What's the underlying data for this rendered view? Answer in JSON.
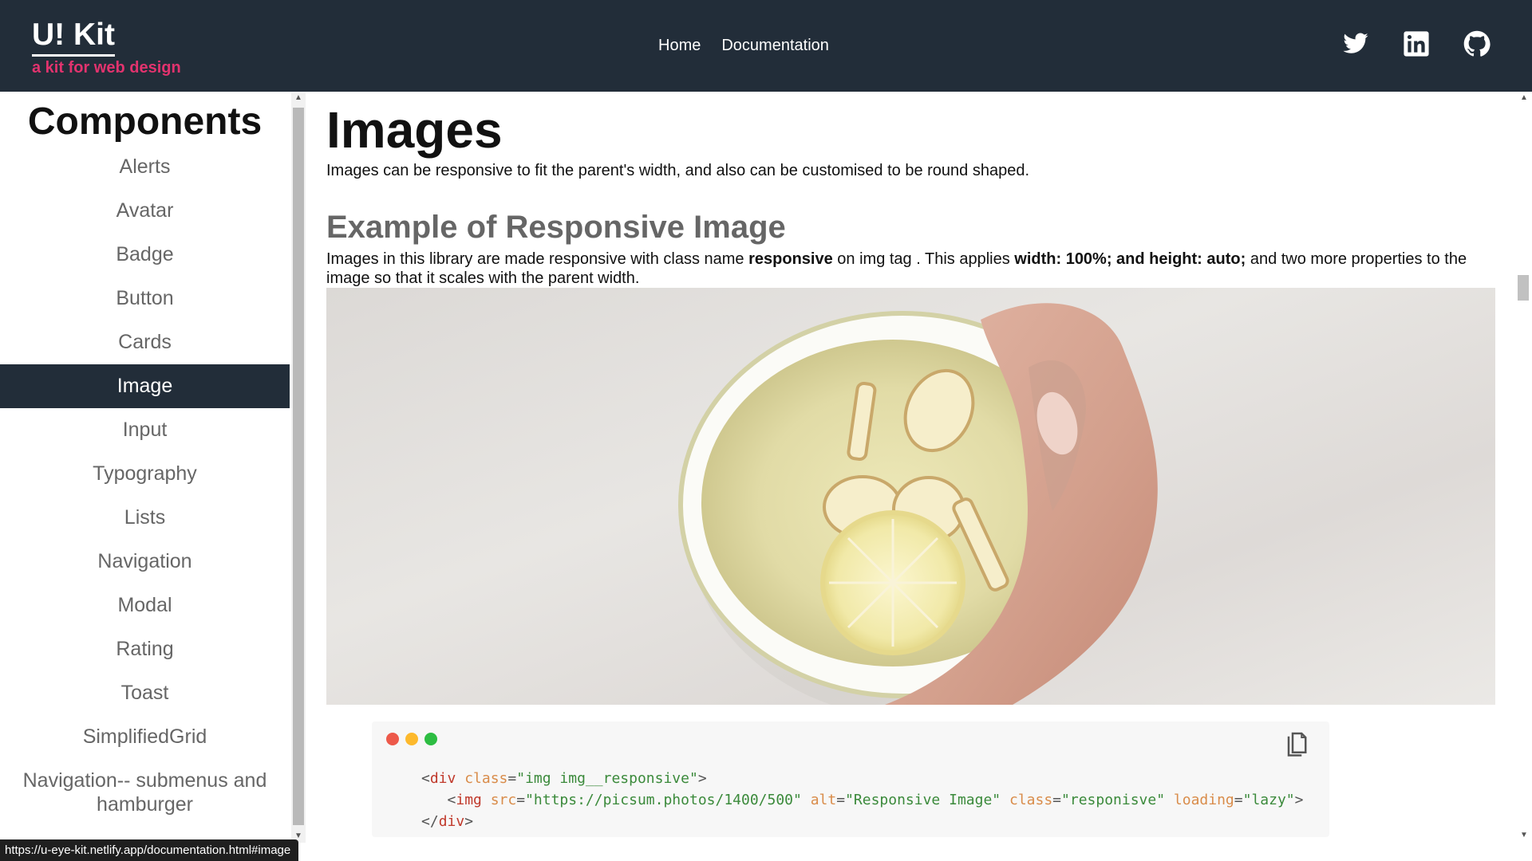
{
  "brand": {
    "title": "U! Kit",
    "tagline": "a kit for web design",
    "accent_color": "#e2336e",
    "header_bg": "#222d39"
  },
  "nav": {
    "home": "Home",
    "documentation": "Documentation"
  },
  "social": {
    "icons": [
      "twitter-icon",
      "linkedin-icon",
      "github-icon"
    ]
  },
  "sidebar": {
    "title": "Components",
    "active": "Image",
    "items": [
      {
        "label": "Alerts"
      },
      {
        "label": "Avatar"
      },
      {
        "label": "Badge"
      },
      {
        "label": "Button"
      },
      {
        "label": "Cards"
      },
      {
        "label": "Image"
      },
      {
        "label": "Input"
      },
      {
        "label": "Typography"
      },
      {
        "label": "Lists"
      },
      {
        "label": "Navigation"
      },
      {
        "label": "Modal"
      },
      {
        "label": "Rating"
      },
      {
        "label": "Toast"
      },
      {
        "label": "SimplifiedGrid"
      },
      {
        "label": "Navigation-- submenus and hamburger"
      }
    ]
  },
  "main": {
    "title": "Images",
    "description": "Images can be responsive to fit the parent's width, and also can be customised to be round shaped.",
    "section": {
      "title": "Example of Responsive Image",
      "desc_part1": "Images in this library are made responsive with class name ",
      "desc_bold1": "responsive",
      "desc_part2": " on img tag . This applies ",
      "desc_bold2": "width: 100%; and height: auto;",
      "desc_part3": " and two more properties to the image so that it scales with the parent width.",
      "image_alt": "Responsive Image"
    }
  },
  "code_block": {
    "dot_colors": [
      "#ed594a",
      "#fdd800",
      "#5ac05a"
    ],
    "line1": {
      "open": "<",
      "tag": "div",
      "attr": "class",
      "eq": "=",
      "value": "\"img img__responsive\"",
      "close": ">"
    },
    "line2": {
      "open": "<",
      "tag": "img",
      "attr1": "src",
      "value1": "\"https://picsum.photos/1400/500\"",
      "attr2": "alt",
      "value2": "\"Responsive Image\"",
      "attr3": "class",
      "value3": "\"responisve\"",
      "attr4": "loading",
      "value4": "\"lazy\"",
      "close": ">"
    },
    "line3": {
      "open": "</",
      "tag": "div",
      "close": ">"
    }
  },
  "status_url": "https://u-eye-kit.netlify.app/documentation.html#image"
}
